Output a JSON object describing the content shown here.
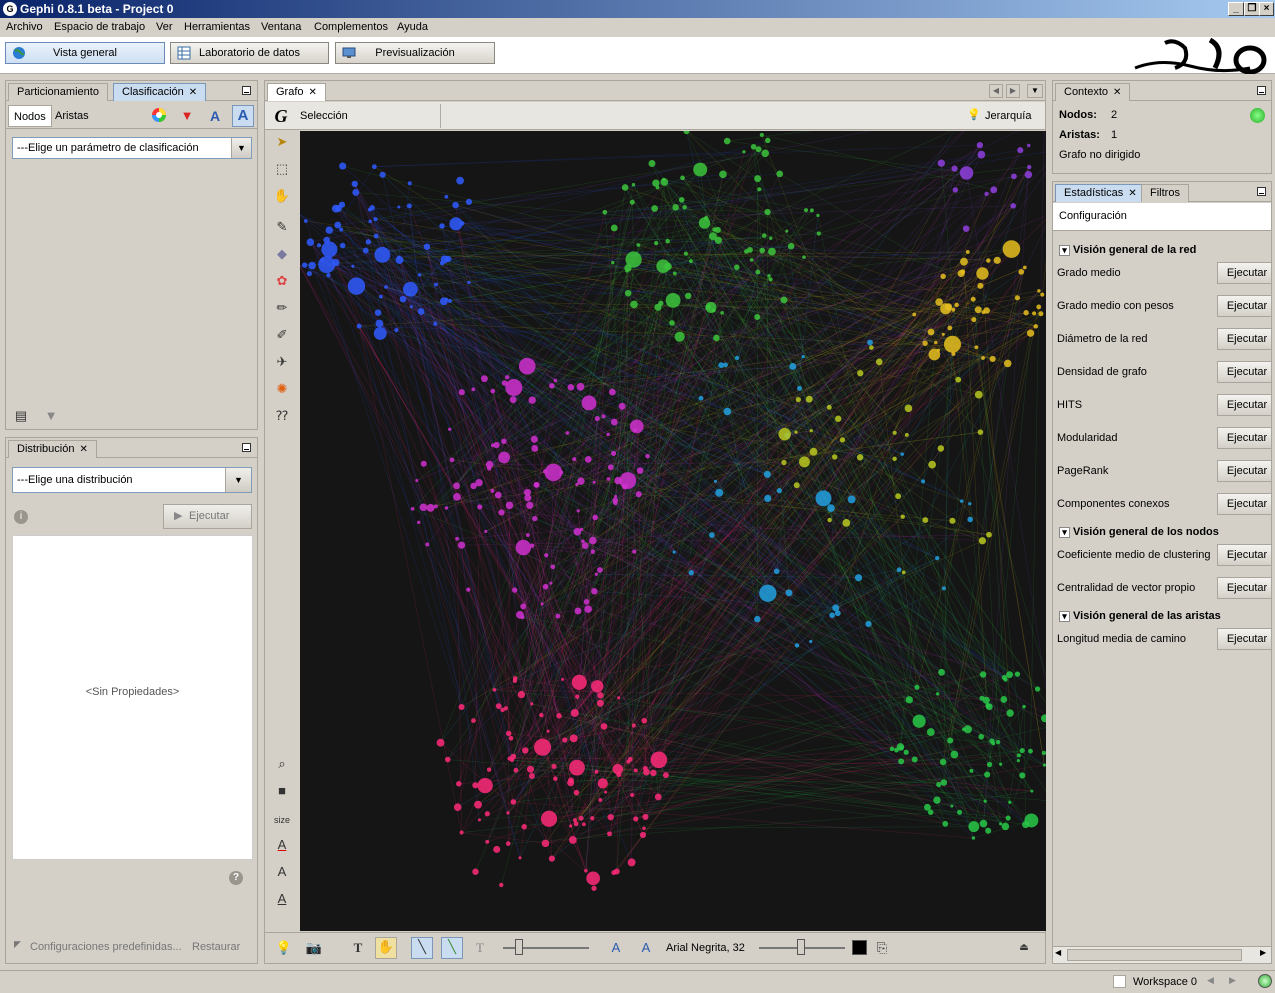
{
  "window": {
    "title": "Gephi 0.8.1 beta - Project 0"
  },
  "menu": [
    "Archivo",
    "Espacio de trabajo",
    "Ver",
    "Herramientas",
    "Ventana",
    "Complementos",
    "Ayuda"
  ],
  "workspaces": {
    "overview": "Vista general",
    "data_lab": "Laboratorio de datos",
    "preview": "Previsualización"
  },
  "ranking_panel": {
    "tabs": [
      "Particionamiento",
      "Clasificación"
    ],
    "subtabs": [
      "Nodos",
      "Aristas"
    ],
    "param_placeholder": "---Elige un parámetro de clasificación"
  },
  "distribution_panel": {
    "title": "Distribución",
    "select": "---Elige una distribución",
    "run": "Ejecutar",
    "empty": "<Sin Propiedades>",
    "presets": "Configuraciones predefinidas...",
    "reset": "Restaurar"
  },
  "graph_panel": {
    "title": "Grafo",
    "selection": "Selección",
    "hierarchy": "Jerarquía",
    "size_label": "size",
    "font": "Arial Negrita, 32"
  },
  "context_panel": {
    "title": "Contexto",
    "nodes_label": "Nodos:",
    "nodes_value": "2",
    "edges_label": "Aristas:",
    "edges_value": "1",
    "graph_type": "Grafo no dirigido"
  },
  "stats_panel": {
    "tabs": [
      "Estadísticas",
      "Filtros"
    ],
    "config": "Configuración",
    "run_label": "Ejecutar",
    "sections": [
      {
        "title": "Visión general de la red",
        "items": [
          "Grado medio",
          "Grado medio con pesos",
          "Diámetro de la red",
          "Densidad de grafo",
          "HITS",
          "Modularidad",
          "PageRank",
          "Componentes conexos"
        ]
      },
      {
        "title": "Visión general de los nodos",
        "items": [
          "Coeficiente medio de clustering",
          "Centralidad de vector propio"
        ]
      },
      {
        "title": "Visión general de las aristas",
        "items": [
          "Longitud media de camino"
        ]
      }
    ]
  },
  "status": {
    "workspace": "Workspace 0"
  }
}
